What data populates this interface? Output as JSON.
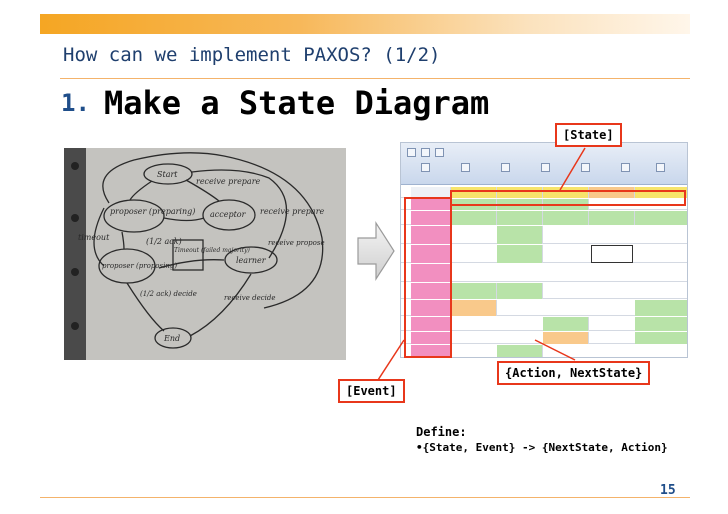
{
  "slide": {
    "title": "How can we implement PAXOS? (1/2)",
    "heading_number": "1.",
    "heading_text": "Make a State Diagram",
    "page_number": "15"
  },
  "photo": {
    "sketch_labels": [
      "Start",
      "receive prepare",
      "proposer (preparing)",
      "acceptor",
      "receive prepare",
      "timeout",
      "(1/2 ack)",
      "Timeout (failed majority)",
      "proposer (proposing)",
      "learner",
      "receive propose",
      "(1/2 ack) decide",
      "receive decide",
      "End"
    ]
  },
  "callouts": {
    "state_label": "[State]",
    "event_label": "[Event]",
    "action_label": "{Action, NextState}"
  },
  "definition": {
    "label": "Define:",
    "rule": "•{State, Event} -> {NextState, Action}"
  },
  "colors": {
    "accent_orange": "#f5a623",
    "title_blue": "#1f3f6e",
    "callout_red": "#e8371b",
    "event_pink": "#f28fc0",
    "action_green": "#b8e3a8",
    "header_yellow": "#f7e46b"
  }
}
